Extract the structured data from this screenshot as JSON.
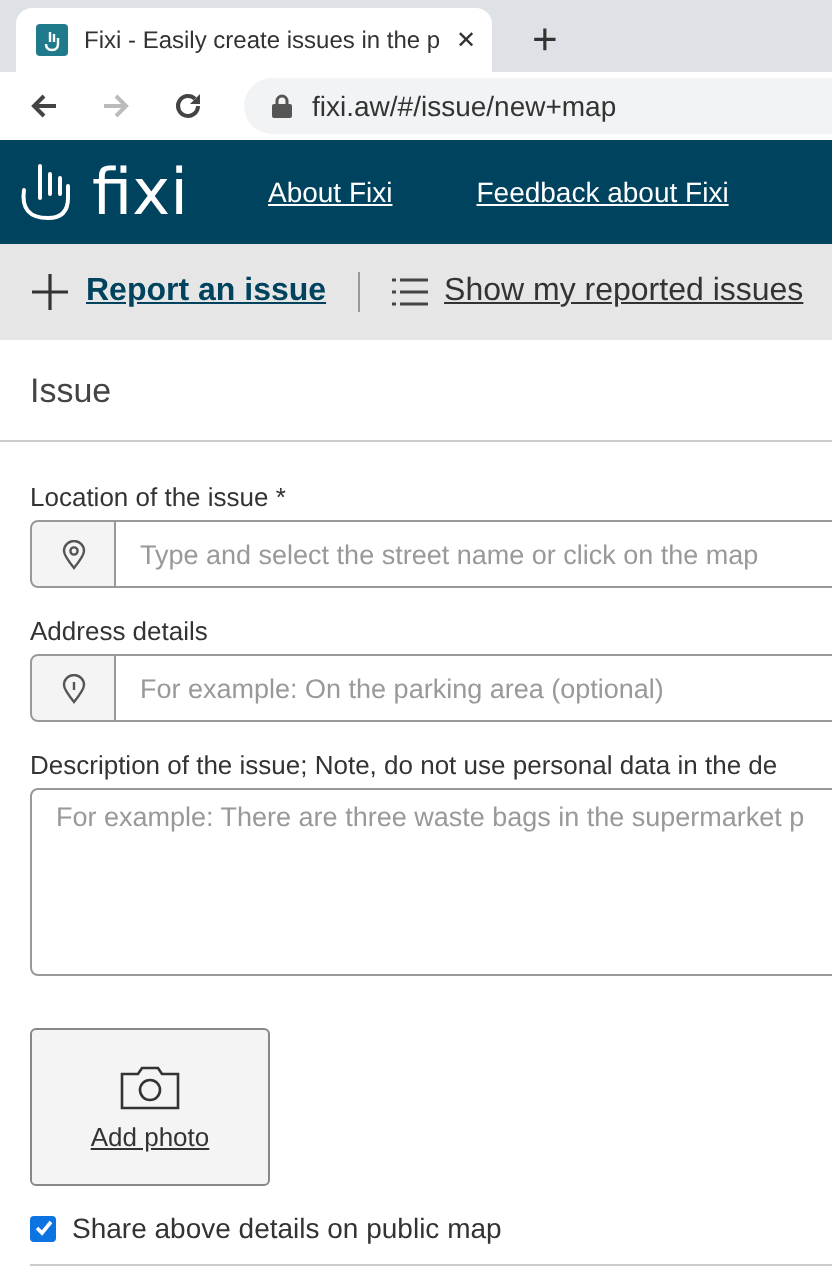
{
  "browser": {
    "tab_title": "Fixi - Easily create issues in the p",
    "close": "✕",
    "new_tab": "+",
    "url": "fixi.aw/#/issue/new+map"
  },
  "header": {
    "logo": "fixi",
    "links": [
      "About Fixi",
      "Feedback about Fixi"
    ]
  },
  "subnav": [
    {
      "label": "Report an issue",
      "selected": true,
      "kind": "plus"
    },
    {
      "label": "Show my reported issues",
      "selected": false,
      "kind": "list"
    }
  ],
  "section_title": "Issue",
  "fields": [
    {
      "label": "Location of the issue *",
      "placeholder": "Type and select the street name or click on the map",
      "kind": "pin"
    },
    {
      "label": "Address details",
      "placeholder": "For example: On the parking area (optional)",
      "kind": "info"
    }
  ],
  "description": {
    "label": "Description of the issue; Note, do not use personal data in the de",
    "placeholder": "For example: There are three waste bags in the supermarket p"
  },
  "photo_button": "Add photo",
  "share": {
    "label": "Share above details on public map",
    "checked": true
  }
}
